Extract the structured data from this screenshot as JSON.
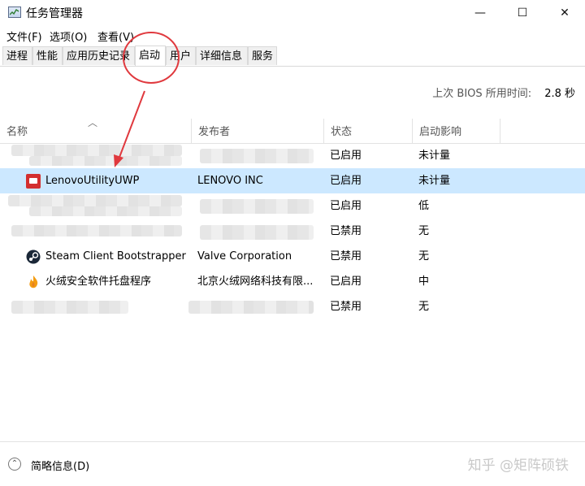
{
  "window": {
    "title": "任务管理器",
    "controls": {
      "minimize": "—",
      "maximize": "☐",
      "close": "✕"
    }
  },
  "menu": [
    "文件(F)",
    "选项(O)",
    "查看(V)"
  ],
  "tabs": [
    "进程",
    "性能",
    "应用历史记录",
    "启动",
    "用户",
    "详细信息",
    "服务"
  ],
  "active_tab": "启动",
  "bios": {
    "label": "上次 BIOS 所用时间:",
    "value": "2.8 秒"
  },
  "columns": [
    "名称",
    "发布者",
    "状态",
    "启动影响"
  ],
  "rows": [
    {
      "name": "",
      "publisher": "",
      "status": "已启用",
      "impact": "未计量",
      "icon": "blurred-icon",
      "redacted": true
    },
    {
      "name": "LenovoUtilityUWP",
      "publisher": "LENOVO INC",
      "status": "已启用",
      "impact": "未计量",
      "icon": "lenovo-icon",
      "selected": true
    },
    {
      "name": "",
      "publisher": "",
      "status": "已启用",
      "impact": "低",
      "icon": "blurred-icon",
      "redacted": true
    },
    {
      "name": "",
      "publisher": "",
      "status": "已禁用",
      "impact": "无",
      "icon": "blurred-icon",
      "redacted": true
    },
    {
      "name": "Steam Client Bootstrapper",
      "publisher": "Valve Corporation",
      "status": "已禁用",
      "impact": "无",
      "icon": "steam-icon"
    },
    {
      "name": "火绒安全软件托盘程序",
      "publisher": "北京火绒网络科技有限...",
      "status": "已启用",
      "impact": "中",
      "icon": "huorong-icon"
    },
    {
      "name": "",
      "publisher": "",
      "status": "已禁用",
      "impact": "无",
      "icon": "blurred-icon",
      "redacted": true
    }
  ],
  "footer": {
    "label": "简略信息(D)"
  },
  "watermark": "知乎 @矩阵硕铁",
  "colors": {
    "selected_row": "#cce8ff",
    "annotation": "#e0393e"
  }
}
